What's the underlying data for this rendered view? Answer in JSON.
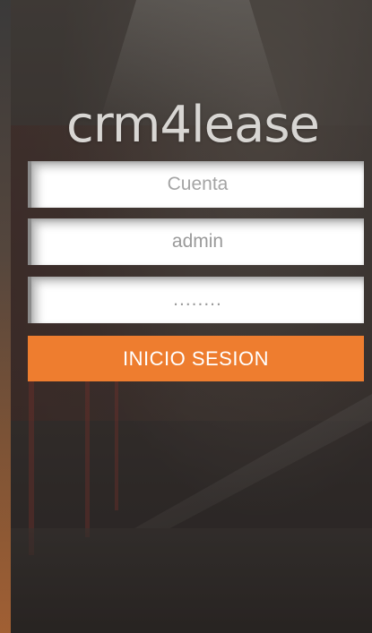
{
  "app": {
    "logo_text": "crm4lease"
  },
  "login_form": {
    "account_placeholder": "Cuenta",
    "username_value": "admin",
    "password_value": "........",
    "submit_label": "INICIO SESION"
  },
  "colors": {
    "accent": "#ee7d2f",
    "field_background": "#ffffff",
    "logo_text": "#d8d6d3"
  }
}
